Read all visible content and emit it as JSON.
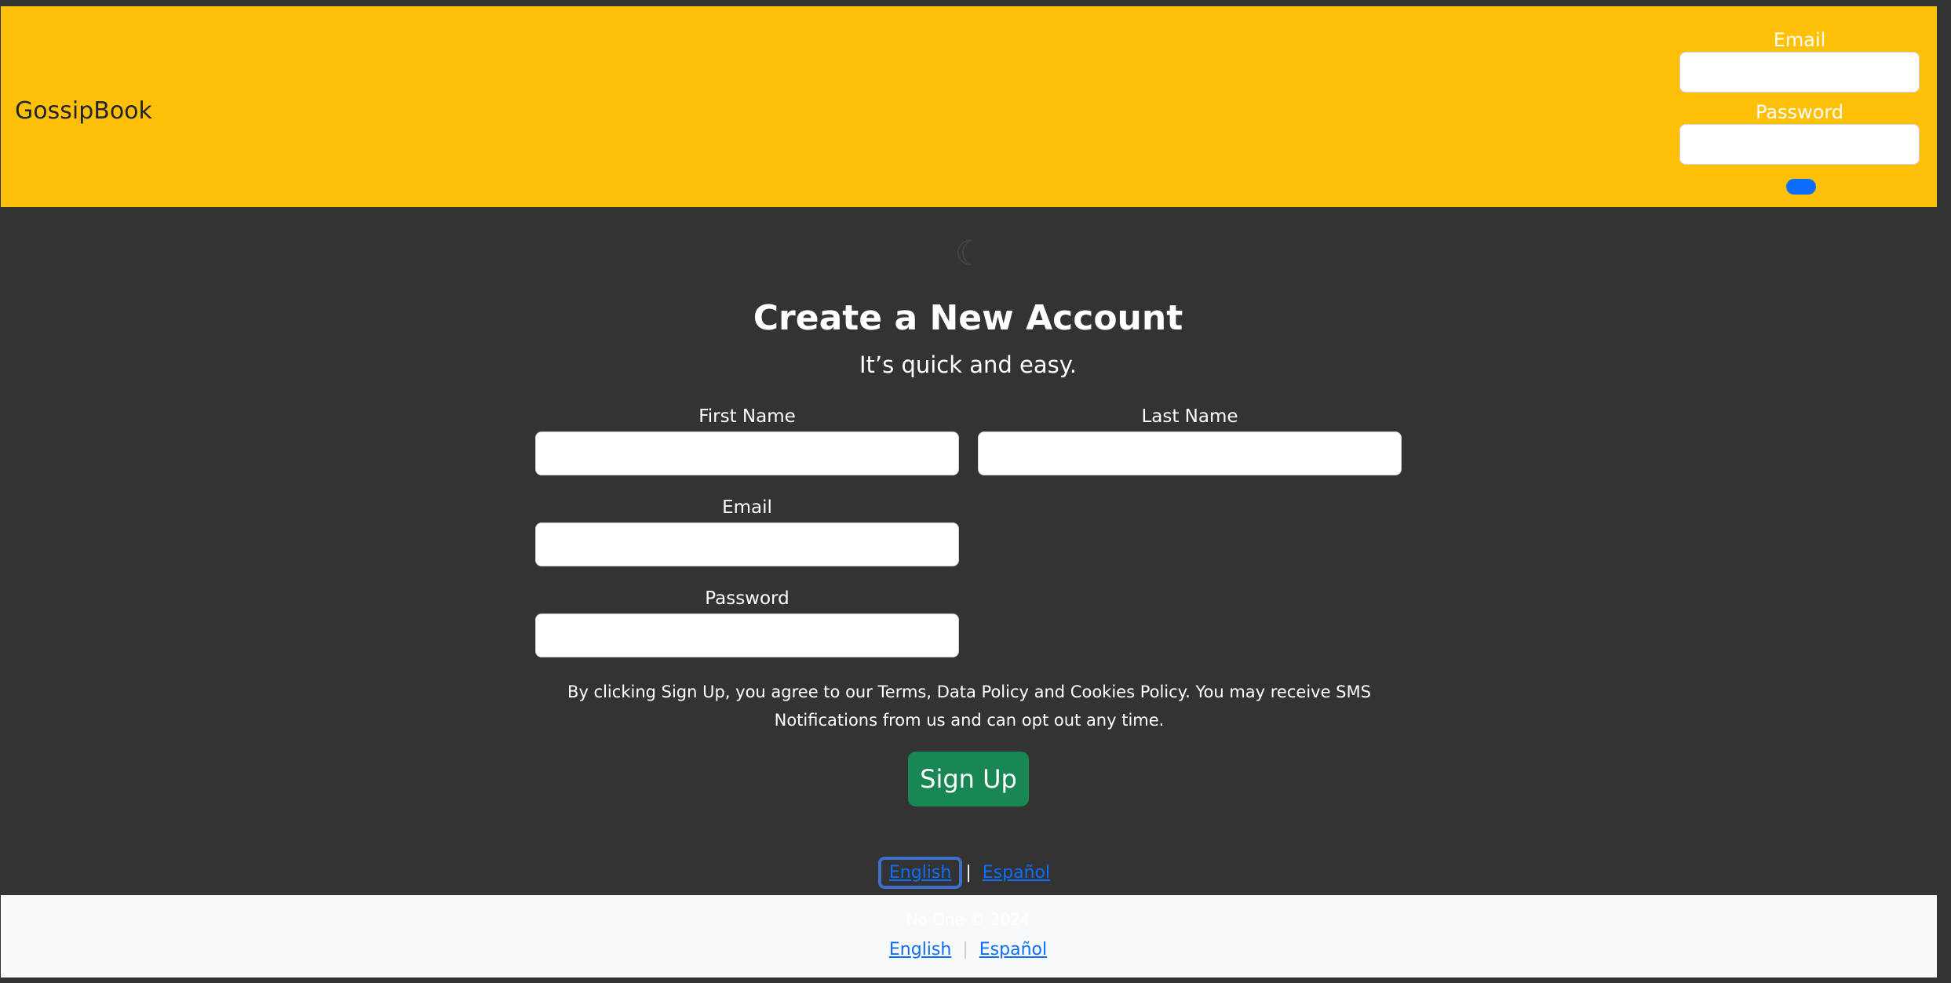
{
  "header": {
    "brand": "GossipBook",
    "login": {
      "email_label": "Email",
      "password_label": "Password"
    }
  },
  "main": {
    "title": "Create a New Account",
    "subtitle": "It’s quick and easy.",
    "fields": {
      "first_name_label": "First Name",
      "last_name_label": "Last Name",
      "email_label": "Email",
      "password_label": "Password"
    },
    "terms": "By clicking Sign Up, you agree to our Terms, Data Policy and Cookies Policy. You may receive SMS Notifications from us and can opt out any time.",
    "signup_label": "Sign Up"
  },
  "languages": {
    "english": "English",
    "separator": "|",
    "spanish": "Español"
  },
  "footer": {
    "copyright": "No One © 2024",
    "english": "English",
    "separator": "|",
    "spanish": "Español"
  },
  "colors": {
    "header_bg": "#ffc107",
    "page_bg": "#333333",
    "signup_bg": "#198754",
    "link": "#0d6efd",
    "footer_bg": "#f8f9fa"
  }
}
